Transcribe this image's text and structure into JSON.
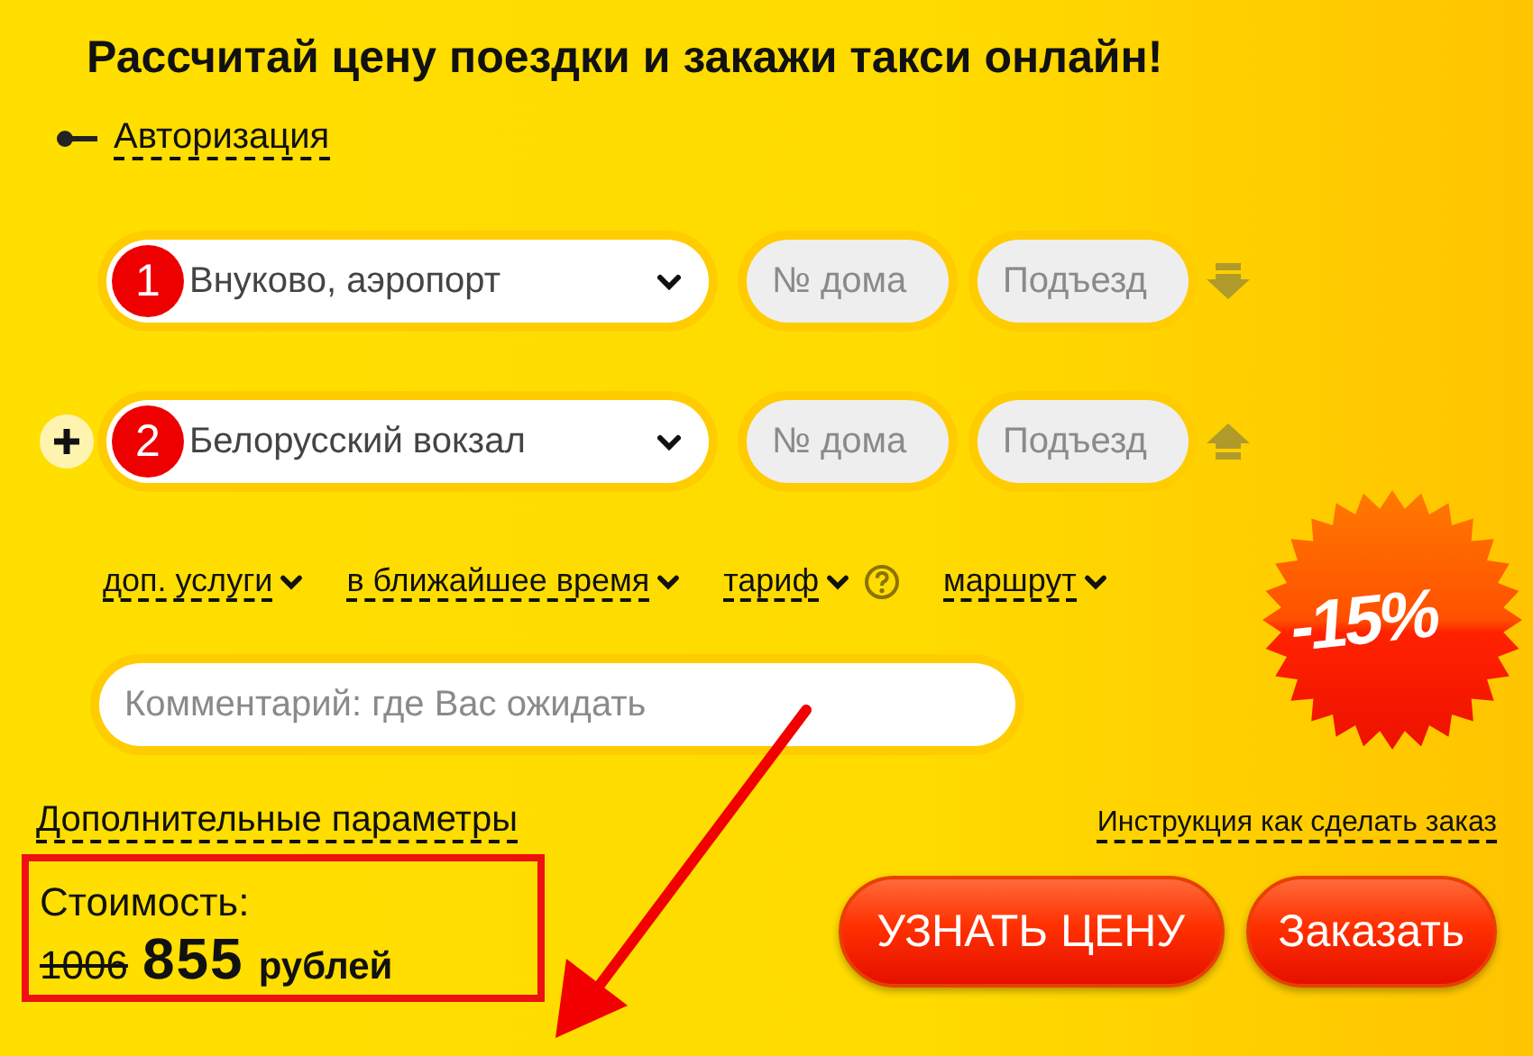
{
  "title": "Рассчитай цену поездки и закажи такси онлайн!",
  "auth_link": "Авторизация",
  "addresses": [
    {
      "number": "1",
      "value": "Внуково, аэропорт",
      "house_placeholder": "№ дома",
      "entrance_placeholder": "Подъезд",
      "kind": "down",
      "add_button": false
    },
    {
      "number": "2",
      "value": "Белорусский вокзал",
      "house_placeholder": "№ дома",
      "entrance_placeholder": "Подъезд",
      "kind": "up",
      "add_button": true
    }
  ],
  "options": [
    {
      "label": "доп. услуги",
      "help": false
    },
    {
      "label": "в ближайшее время",
      "help": false
    },
    {
      "label": "тариф",
      "help": true
    },
    {
      "label": "маршрут",
      "help": false
    }
  ],
  "comment": {
    "placeholder": "Комментарий: где Вас ожидать"
  },
  "discount_badge": "-15%",
  "extra_params_link": "Дополнительные параметры",
  "instructions_link": "Инструкция как сделать заказ",
  "price": {
    "label": "Стоимость:",
    "old": "1006",
    "new": "855",
    "currency": "рублей"
  },
  "buttons": [
    {
      "label": "УЗНАТЬ ЦЕНУ"
    },
    {
      "label": "Заказать"
    }
  ]
}
